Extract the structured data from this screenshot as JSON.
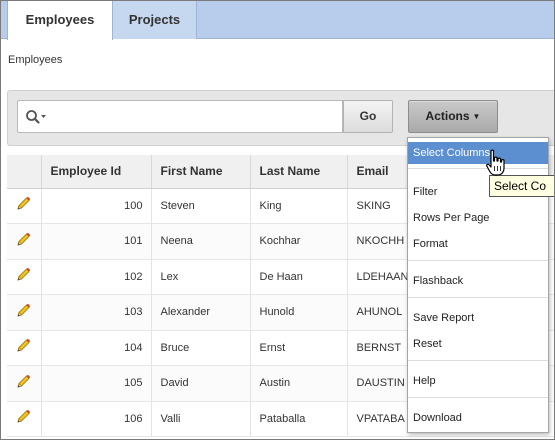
{
  "tabs": [
    {
      "label": "Employees"
    },
    {
      "label": "Projects"
    }
  ],
  "breadcrumb": "Employees",
  "toolbar": {
    "go_label": "Go",
    "actions_label": "Actions"
  },
  "table": {
    "headers": [
      "Employee Id",
      "First Name",
      "Last Name",
      "Email"
    ],
    "rows": [
      {
        "id": "100",
        "first": "Steven",
        "last": "King",
        "email": "SKING"
      },
      {
        "id": "101",
        "first": "Neena",
        "last": "Kochhar",
        "email": "NKOCHH"
      },
      {
        "id": "102",
        "first": "Lex",
        "last": "De Haan",
        "email": "LDEHAAN"
      },
      {
        "id": "103",
        "first": "Alexander",
        "last": "Hunold",
        "email": "AHUNOL"
      },
      {
        "id": "104",
        "first": "Bruce",
        "last": "Ernst",
        "email": "BERNST"
      },
      {
        "id": "105",
        "first": "David",
        "last": "Austin",
        "email": "DAUSTIN"
      },
      {
        "id": "106",
        "first": "Valli",
        "last": "Pataballa",
        "email": "VPATABA"
      }
    ]
  },
  "actions_menu": {
    "items": [
      "Select Columns",
      "Filter",
      "Rows Per Page",
      "Format",
      "Flashback",
      "Save Report",
      "Reset",
      "Help",
      "Download"
    ],
    "highlighted": "Select Columns"
  },
  "tooltip": "Select Co",
  "icons": {
    "search": "search-icon",
    "edit": "pencil-icon",
    "caret": "caret-down-icon",
    "cursor": "hand-cursor-icon"
  },
  "colors": {
    "tab_bar": "#b7cdeb",
    "menu_highlight": "#5b8fd0",
    "tooltip_bg": "#ffffe1"
  }
}
